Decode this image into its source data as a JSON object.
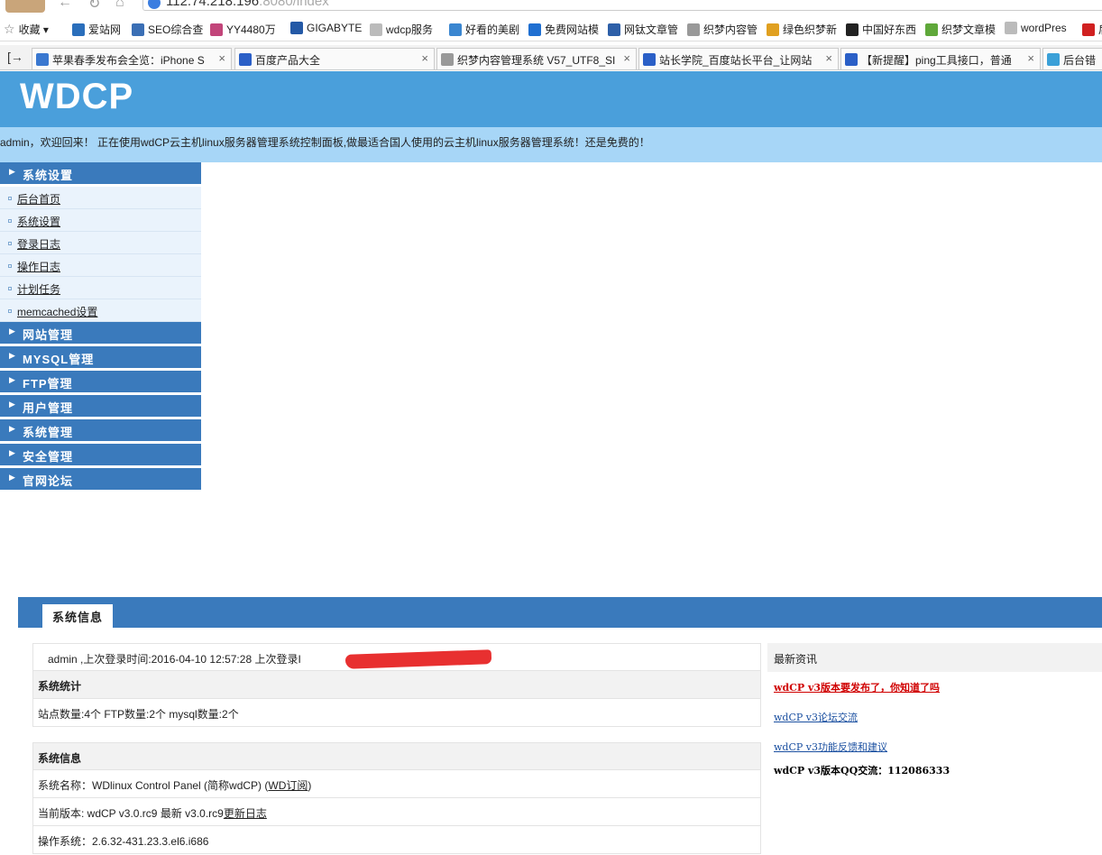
{
  "browser": {
    "url_host": "112.74.218.196",
    "url_rest": ":8080/index",
    "bookmarks": [
      {
        "label": "收藏 ▾",
        "icon": "star-icon",
        "color": "#777777"
      },
      {
        "label": "爱站网",
        "icon": "aizhan-icon",
        "color": "#2a6ebb"
      },
      {
        "label": "SEO综合查",
        "icon": "seo-icon",
        "color": "#3b6fb5"
      },
      {
        "label": "YY4480万",
        "icon": "yy-icon",
        "color": "#c2457a"
      },
      {
        "label": "GIGABYTE",
        "icon": "gigabyte-icon",
        "color": "#2459a6"
      },
      {
        "label": "wdcp服务",
        "icon": "page-icon",
        "color": "#bbbbbb"
      },
      {
        "label": "好看的美剧",
        "icon": "tv-icon",
        "color": "#3a86d0"
      },
      {
        "label": "免费网站模",
        "icon": "five-icon",
        "color": "#1f6fd1"
      },
      {
        "label": "网钛文章管",
        "icon": "wt-icon",
        "color": "#2d5fa8"
      },
      {
        "label": "织梦内容管",
        "icon": "dede-icon",
        "color": "#999999"
      },
      {
        "label": "绿色织梦新",
        "icon": "green-dede-icon",
        "color": "#e0a020"
      },
      {
        "label": "中国好东西",
        "icon": "cn-icon",
        "color": "#222222"
      },
      {
        "label": "织梦文章模",
        "icon": "zhi-icon",
        "color": "#5fa83a"
      },
      {
        "label": "wordPres",
        "icon": "page-icon",
        "color": "#bbbbbb"
      },
      {
        "label": "后台",
        "icon": "zhan-icon",
        "color": "#d02020"
      }
    ],
    "tabs": [
      {
        "label": "苹果春季发布会全览：iPhone S",
        "color": "#3a78d0"
      },
      {
        "label": "百度产品大全",
        "color": "#2a5fc7"
      },
      {
        "label": "织梦内容管理系统 V57_UTF8_SI",
        "color": "#999999"
      },
      {
        "label": "站长学院_百度站长平台_让网站",
        "color": "#2a5fc7"
      },
      {
        "label": "【新提醒】ping工具接口，普通",
        "color": "#2a5fc7"
      },
      {
        "label": "后台错",
        "color": "#3aa0d8"
      }
    ]
  },
  "app": {
    "logo": "WDCP",
    "welcome": "admin，欢迎回来！ 正在使用wdCP云主机linux服务器管理系统控制面板,做最适合国人使用的云主机linux服务器管理系统！还是免费的！"
  },
  "sidebar": {
    "groups": [
      {
        "label": "系统设置",
        "items": [
          "后台首页",
          "系统设置",
          "登录日志",
          "操作日志",
          "计划任务",
          "memcached设置"
        ]
      },
      {
        "label": "网站管理"
      },
      {
        "label": "MYSQL管理"
      },
      {
        "label": "FTP管理"
      },
      {
        "label": "用户管理"
      },
      {
        "label": "系统管理"
      },
      {
        "label": "安全管理"
      },
      {
        "label": "官网论坛"
      }
    ]
  },
  "panel": {
    "tab": "系统信息",
    "login_line": "admin ,上次登录时间:2016-04-10 12:57:28 上次登录I",
    "stats_head": "系统统计",
    "stats_line": "站点数量:4个  FTP数量:2个  mysql数量:2个",
    "info_head": "系统信息",
    "sysname_prefix": "系统名称：WDlinux Control Panel (简称wdCP) (",
    "sysname_link": "WD订阅",
    "sysname_suffix": ")",
    "version_prefix": "当前版本: wdCP v3.0.rc9 最新 v3.0.rc9",
    "version_link": "更新日志",
    "os_line": "操作系统：2.6.32-431.23.3.el6.i686"
  },
  "news": {
    "head": "最新资讯",
    "items": [
      "wdCP v3版本要发布了，你知道了吗",
      "wdCP v3论坛交流",
      "wdCP v3功能反馈和建议"
    ],
    "qq": "wdCP v3版本QQ交流：112086333"
  }
}
